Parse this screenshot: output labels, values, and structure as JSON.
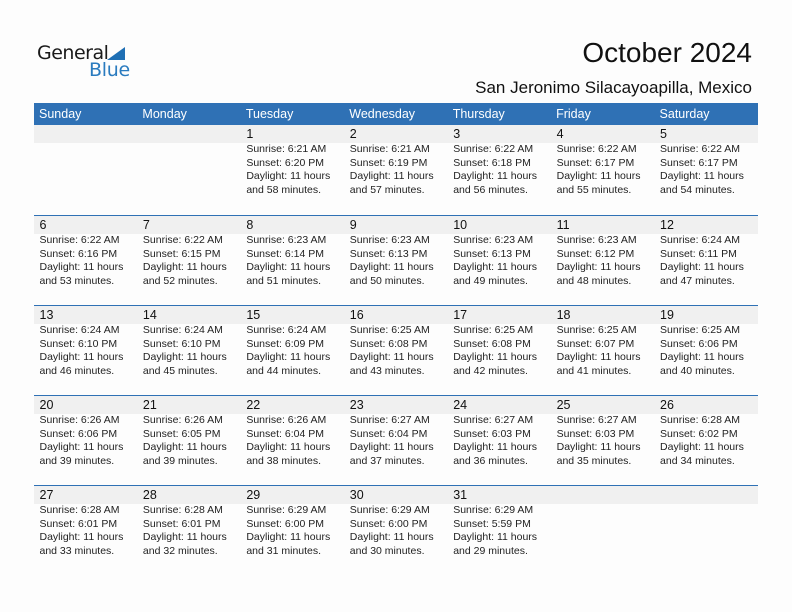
{
  "logo": {
    "word1": "General",
    "word2": "Blue",
    "icon": "triangle-flag-icon",
    "colors": {
      "dark": "#1a1a1a",
      "blue": "#2a7bbf"
    }
  },
  "header": {
    "title": "October 2024",
    "location": "San Jeronimo Silacayoapilla, Mexico"
  },
  "colors": {
    "accent": "#2f71b5",
    "date_strip": "#f0f0f0"
  },
  "weekdays": [
    "Sunday",
    "Monday",
    "Tuesday",
    "Wednesday",
    "Thursday",
    "Friday",
    "Saturday"
  ],
  "labels": {
    "sunrise": "Sunrise:",
    "sunset": "Sunset:",
    "daylight": "Daylight:"
  },
  "weeks": [
    [
      null,
      null,
      {
        "day": "1",
        "sunrise": "Sunrise: 6:21 AM",
        "sunset": "Sunset: 6:20 PM",
        "daylight": "Daylight: 11 hours",
        "minutes": "and 58 minutes."
      },
      {
        "day": "2",
        "sunrise": "Sunrise: 6:21 AM",
        "sunset": "Sunset: 6:19 PM",
        "daylight": "Daylight: 11 hours",
        "minutes": "and 57 minutes."
      },
      {
        "day": "3",
        "sunrise": "Sunrise: 6:22 AM",
        "sunset": "Sunset: 6:18 PM",
        "daylight": "Daylight: 11 hours",
        "minutes": "and 56 minutes."
      },
      {
        "day": "4",
        "sunrise": "Sunrise: 6:22 AM",
        "sunset": "Sunset: 6:17 PM",
        "daylight": "Daylight: 11 hours",
        "minutes": "and 55 minutes."
      },
      {
        "day": "5",
        "sunrise": "Sunrise: 6:22 AM",
        "sunset": "Sunset: 6:17 PM",
        "daylight": "Daylight: 11 hours",
        "minutes": "and 54 minutes."
      }
    ],
    [
      {
        "day": "6",
        "sunrise": "Sunrise: 6:22 AM",
        "sunset": "Sunset: 6:16 PM",
        "daylight": "Daylight: 11 hours",
        "minutes": "and 53 minutes."
      },
      {
        "day": "7",
        "sunrise": "Sunrise: 6:22 AM",
        "sunset": "Sunset: 6:15 PM",
        "daylight": "Daylight: 11 hours",
        "minutes": "and 52 minutes."
      },
      {
        "day": "8",
        "sunrise": "Sunrise: 6:23 AM",
        "sunset": "Sunset: 6:14 PM",
        "daylight": "Daylight: 11 hours",
        "minutes": "and 51 minutes."
      },
      {
        "day": "9",
        "sunrise": "Sunrise: 6:23 AM",
        "sunset": "Sunset: 6:13 PM",
        "daylight": "Daylight: 11 hours",
        "minutes": "and 50 minutes."
      },
      {
        "day": "10",
        "sunrise": "Sunrise: 6:23 AM",
        "sunset": "Sunset: 6:13 PM",
        "daylight": "Daylight: 11 hours",
        "minutes": "and 49 minutes."
      },
      {
        "day": "11",
        "sunrise": "Sunrise: 6:23 AM",
        "sunset": "Sunset: 6:12 PM",
        "daylight": "Daylight: 11 hours",
        "minutes": "and 48 minutes."
      },
      {
        "day": "12",
        "sunrise": "Sunrise: 6:24 AM",
        "sunset": "Sunset: 6:11 PM",
        "daylight": "Daylight: 11 hours",
        "minutes": "and 47 minutes."
      }
    ],
    [
      {
        "day": "13",
        "sunrise": "Sunrise: 6:24 AM",
        "sunset": "Sunset: 6:10 PM",
        "daylight": "Daylight: 11 hours",
        "minutes": "and 46 minutes."
      },
      {
        "day": "14",
        "sunrise": "Sunrise: 6:24 AM",
        "sunset": "Sunset: 6:10 PM",
        "daylight": "Daylight: 11 hours",
        "minutes": "and 45 minutes."
      },
      {
        "day": "15",
        "sunrise": "Sunrise: 6:24 AM",
        "sunset": "Sunset: 6:09 PM",
        "daylight": "Daylight: 11 hours",
        "minutes": "and 44 minutes."
      },
      {
        "day": "16",
        "sunrise": "Sunrise: 6:25 AM",
        "sunset": "Sunset: 6:08 PM",
        "daylight": "Daylight: 11 hours",
        "minutes": "and 43 minutes."
      },
      {
        "day": "17",
        "sunrise": "Sunrise: 6:25 AM",
        "sunset": "Sunset: 6:08 PM",
        "daylight": "Daylight: 11 hours",
        "minutes": "and 42 minutes."
      },
      {
        "day": "18",
        "sunrise": "Sunrise: 6:25 AM",
        "sunset": "Sunset: 6:07 PM",
        "daylight": "Daylight: 11 hours",
        "minutes": "and 41 minutes."
      },
      {
        "day": "19",
        "sunrise": "Sunrise: 6:25 AM",
        "sunset": "Sunset: 6:06 PM",
        "daylight": "Daylight: 11 hours",
        "minutes": "and 40 minutes."
      }
    ],
    [
      {
        "day": "20",
        "sunrise": "Sunrise: 6:26 AM",
        "sunset": "Sunset: 6:06 PM",
        "daylight": "Daylight: 11 hours",
        "minutes": "and 39 minutes."
      },
      {
        "day": "21",
        "sunrise": "Sunrise: 6:26 AM",
        "sunset": "Sunset: 6:05 PM",
        "daylight": "Daylight: 11 hours",
        "minutes": "and 39 minutes."
      },
      {
        "day": "22",
        "sunrise": "Sunrise: 6:26 AM",
        "sunset": "Sunset: 6:04 PM",
        "daylight": "Daylight: 11 hours",
        "minutes": "and 38 minutes."
      },
      {
        "day": "23",
        "sunrise": "Sunrise: 6:27 AM",
        "sunset": "Sunset: 6:04 PM",
        "daylight": "Daylight: 11 hours",
        "minutes": "and 37 minutes."
      },
      {
        "day": "24",
        "sunrise": "Sunrise: 6:27 AM",
        "sunset": "Sunset: 6:03 PM",
        "daylight": "Daylight: 11 hours",
        "minutes": "and 36 minutes."
      },
      {
        "day": "25",
        "sunrise": "Sunrise: 6:27 AM",
        "sunset": "Sunset: 6:03 PM",
        "daylight": "Daylight: 11 hours",
        "minutes": "and 35 minutes."
      },
      {
        "day": "26",
        "sunrise": "Sunrise: 6:28 AM",
        "sunset": "Sunset: 6:02 PM",
        "daylight": "Daylight: 11 hours",
        "minutes": "and 34 minutes."
      }
    ],
    [
      {
        "day": "27",
        "sunrise": "Sunrise: 6:28 AM",
        "sunset": "Sunset: 6:01 PM",
        "daylight": "Daylight: 11 hours",
        "minutes": "and 33 minutes."
      },
      {
        "day": "28",
        "sunrise": "Sunrise: 6:28 AM",
        "sunset": "Sunset: 6:01 PM",
        "daylight": "Daylight: 11 hours",
        "minutes": "and 32 minutes."
      },
      {
        "day": "29",
        "sunrise": "Sunrise: 6:29 AM",
        "sunset": "Sunset: 6:00 PM",
        "daylight": "Daylight: 11 hours",
        "minutes": "and 31 minutes."
      },
      {
        "day": "30",
        "sunrise": "Sunrise: 6:29 AM",
        "sunset": "Sunset: 6:00 PM",
        "daylight": "Daylight: 11 hours",
        "minutes": "and 30 minutes."
      },
      {
        "day": "31",
        "sunrise": "Sunrise: 6:29 AM",
        "sunset": "Sunset: 5:59 PM",
        "daylight": "Daylight: 11 hours",
        "minutes": "and 29 minutes."
      },
      null,
      null
    ]
  ]
}
